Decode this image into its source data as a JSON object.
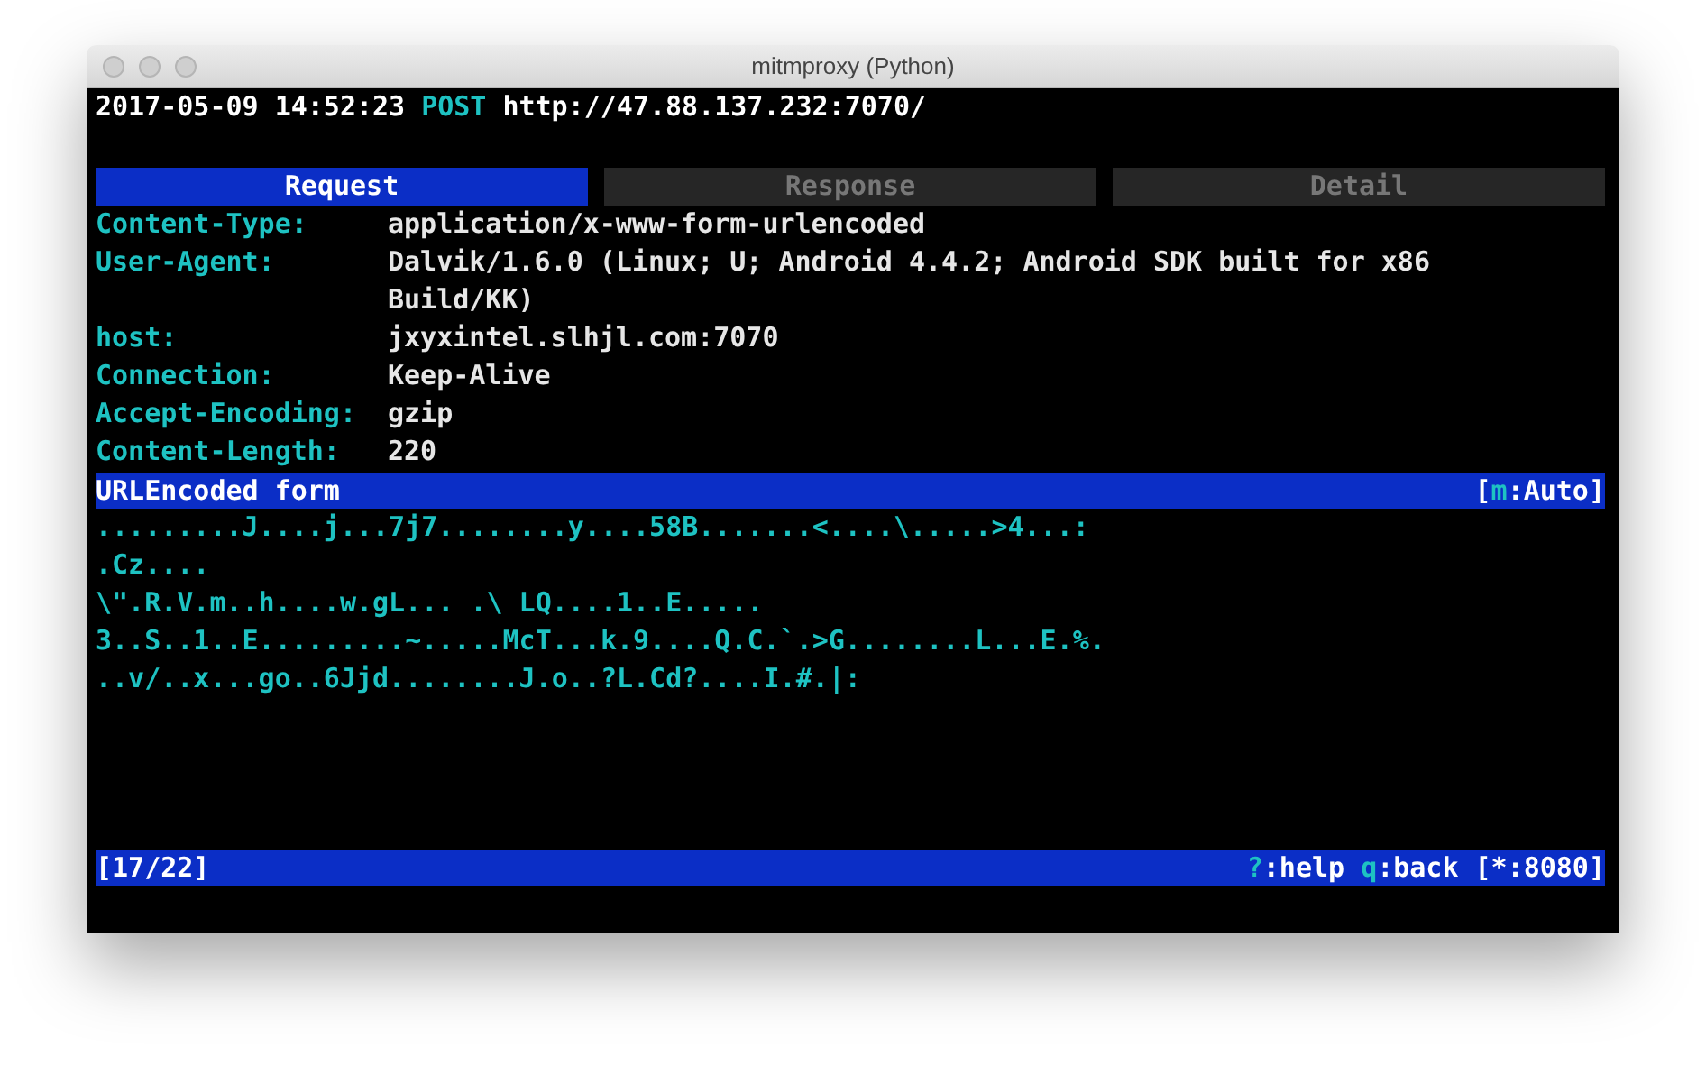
{
  "window": {
    "title": "mitmproxy (Python)"
  },
  "flow": {
    "timestamp": "2017-05-09 14:52:23",
    "method": "POST",
    "url": "http://47.88.137.232:7070/"
  },
  "tabs": [
    {
      "label": "Request",
      "selected": true
    },
    {
      "label": "Response",
      "selected": false
    },
    {
      "label": "Detail",
      "selected": false
    }
  ],
  "headers": [
    {
      "name": "Content-Type:",
      "lines": [
        "application/x-www-form-urlencoded"
      ]
    },
    {
      "name": "User-Agent:",
      "lines": [
        "Dalvik/1.6.0 (Linux; U; Android 4.4.2; Android SDK built for x86",
        "Build/KK)"
      ]
    },
    {
      "name": "host:",
      "lines": [
        "jxyxintel.slhjl.com:7070"
      ]
    },
    {
      "name": "Connection:",
      "lines": [
        "Keep-Alive"
      ]
    },
    {
      "name": "Accept-Encoding:",
      "lines": [
        "gzip"
      ]
    },
    {
      "name": "Content-Length:",
      "lines": [
        "220"
      ]
    }
  ],
  "body_bar": {
    "title": "URLEncoded form",
    "mode": [
      {
        "text": "[",
        "kind": "plain"
      },
      {
        "text": "m",
        "kind": "key"
      },
      {
        "text": ":Auto]",
        "kind": "plain"
      }
    ]
  },
  "body_lines": [
    ".........J....j...7j7........y....58B.......<....\\.....>4...:",
    ".Cz....",
    "\\\".R.V.m..h....w.gL... .\\ LQ....1..E.....",
    "3..S..1..E.........~.....McT...k.9....Q.C.`.>G........L...E.%.",
    "..v/..x...go..6Jjd........J.o..?L.Cd?....I.#.|:"
  ],
  "status_bar": {
    "position": "[17/22]",
    "hints": [
      [
        {
          "text": "?",
          "kind": "key"
        },
        {
          "text": ":help",
          "kind": "plain"
        }
      ],
      [
        {
          "text": "q",
          "kind": "key"
        },
        {
          "text": ":back",
          "kind": "plain"
        }
      ],
      [
        {
          "text": "[*:8080]",
          "kind": "plain"
        }
      ]
    ]
  }
}
